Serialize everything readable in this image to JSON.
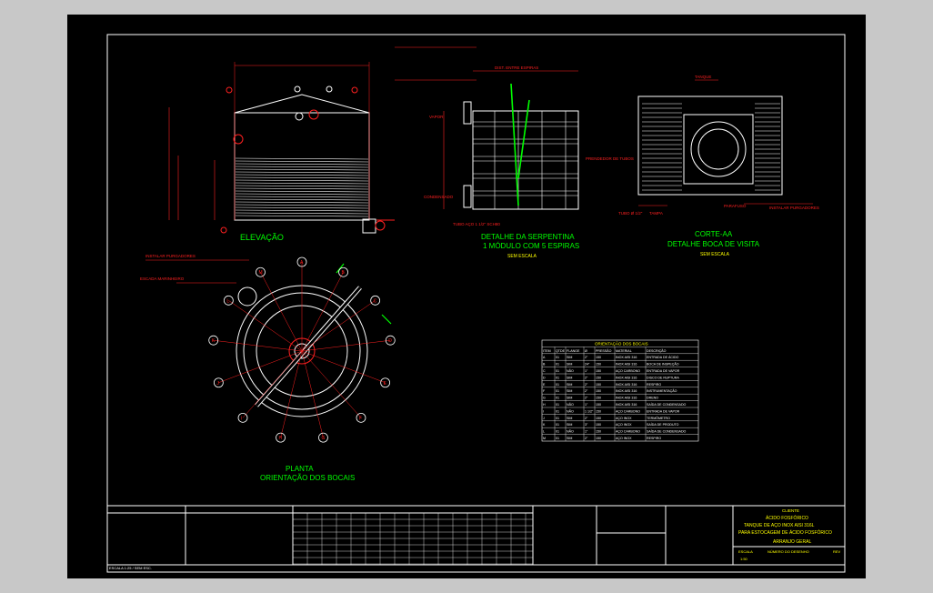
{
  "titles": {
    "elevation": "ELEVAÇÃO",
    "serpentine_1": "DETALHE DA SERPENTINA",
    "serpentine_2": "1 MÓDULO COM 5 ESPIRAS",
    "serpentine_3": "SEM ESCALA",
    "section_1": "CORTE-AA",
    "section_2": "DETALHE BOCA DE VISITA",
    "section_3": "SEM ESCALA",
    "plan_1": "PLANTA",
    "plan_2": "ORIENTAÇÃO DOS BOCAIS"
  },
  "notes": {
    "dist": "DIST. ENTRE ESPIRAS",
    "vapor": "VAPOR",
    "condensado": "CONDENSADO",
    "tubo": "TUBO AÇO 1 1/2\" SCH80",
    "prendedor": "PRENDEDOR DE TUBOS",
    "isolante": "ISOLANTE TÉRMICO",
    "tanque": "TANQUE",
    "tampa": "TAMPA",
    "parafuso": "PARAFUSO",
    "tubo_sec": "TUBO Ø 1/2\"",
    "escada": "ESCADA MARINHEIRO",
    "purgador": "INSTALAR PURGADORES"
  },
  "nozzle_table": {
    "title": "ORIENTAÇÃO DOS BOCAIS",
    "headers": [
      "ITEM",
      "QTDE",
      "FLANGE",
      "Ø",
      "PRESSÃO",
      "MATERIAL",
      "DESCRIÇÃO"
    ],
    "rows": [
      [
        "A",
        "01",
        "SIM",
        "2\"",
        "150",
        "INOX AISI 316",
        "ENTRADA DE ÁCIDO"
      ],
      [
        "B",
        "01",
        "SIM",
        "24\"",
        "150",
        "INOX AISI 316",
        "BOCA DE INSPEÇÃO"
      ],
      [
        "C",
        "01",
        "NÃO",
        "1\"",
        "150",
        "AÇO CARBONO",
        "ENTRADA DE VAPOR"
      ],
      [
        "D",
        "01",
        "SIM",
        "2\"",
        "150",
        "INOX AISI 316",
        "DISCO DE RUPTURA"
      ],
      [
        "E",
        "01",
        "SIM",
        "2\"",
        "150",
        "INOX AISI 316",
        "RESPIRO"
      ],
      [
        "F",
        "01",
        "SIM",
        "2\"",
        "150",
        "INOX AISI 316",
        "INSTRUMENTAÇÃO"
      ],
      [
        "G",
        "01",
        "SIM",
        "2\"",
        "150",
        "INOX AISI 316",
        "DRENO"
      ],
      [
        "H",
        "01",
        "NÃO",
        "1\"",
        "150",
        "INOX AISI 316",
        "SAÍDA DE CONDENSADO"
      ],
      [
        "I",
        "01",
        "NÃO",
        "1 1/2\"",
        "150",
        "AÇO CARBONO",
        "ENTRADA DE VAPOR"
      ],
      [
        "J",
        "01",
        "SIM",
        "2\"",
        "150",
        "AÇO INOX",
        "TERMÔMETRO"
      ],
      [
        "K",
        "01",
        "SIM",
        "3\"",
        "150",
        "AÇO INOX",
        "SAÍDA DE PRODUTO"
      ],
      [
        "L",
        "01",
        "NÃO",
        "1\"",
        "150",
        "AÇO CARBONO",
        "SAÍDA DE CONDENSADO"
      ],
      [
        "M",
        "01",
        "SIM",
        "2\"",
        "150",
        "AÇO INOX",
        "RESPIRO"
      ]
    ]
  },
  "title_block": {
    "company": "CLIENTE",
    "line1": "ÁCIDO FOSFÓRICO",
    "line2": "TANQUE DE AÇO INOX AISI 316L",
    "line3": "PARA ESTOCAGEM DE ÁCIDO FOSFÓRICO",
    "line4": "ARRANJO GERAL",
    "rev_label": "REV",
    "scale_label": "ESCALA",
    "scale_value": "1:50",
    "desenho_label": "NÚMERO DO DESENHO",
    "footer": "ESCALA 1:25 / SEM ESC."
  },
  "plan_labels": [
    "A",
    "B",
    "C",
    "D",
    "E",
    "F",
    "G",
    "H",
    "I",
    "J",
    "K",
    "L",
    "M"
  ],
  "colors": {
    "background": "#000000",
    "border": "#ffffff",
    "green": "#00ff00",
    "red": "#ff2020",
    "yellow": "#ffff00",
    "cyan": "#00ffff",
    "magenta": "#ff40ff"
  }
}
